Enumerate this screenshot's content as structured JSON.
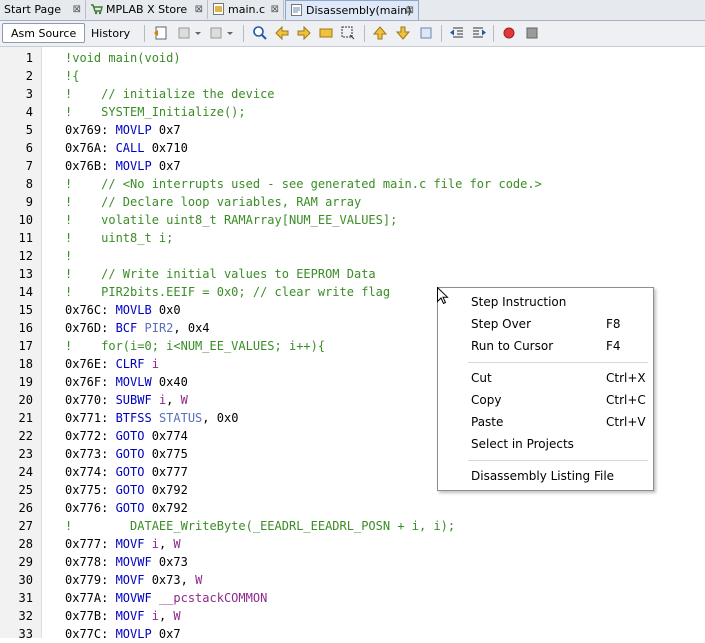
{
  "tabs": [
    {
      "label": "Start Page"
    },
    {
      "label": "MPLAB X Store"
    },
    {
      "label": "main.c"
    },
    {
      "label": "Disassembly(main)"
    }
  ],
  "toolbar": {
    "asm_source": "Asm Source",
    "history": "History"
  },
  "lines": [
    {
      "n": "1",
      "parts": [
        {
          "t": "!void main(void)",
          "c": "src"
        }
      ]
    },
    {
      "n": "2",
      "parts": [
        {
          "t": "!{",
          "c": "src"
        }
      ]
    },
    {
      "n": "3",
      "parts": [
        {
          "t": "!    // initialize the device",
          "c": "src"
        }
      ]
    },
    {
      "n": "4",
      "parts": [
        {
          "t": "!    SYSTEM_Initialize();",
          "c": "src"
        }
      ]
    },
    {
      "n": "5",
      "parts": [
        {
          "t": "0x769: ",
          "c": "addr"
        },
        {
          "t": "MOVLP",
          "c": "kw"
        },
        {
          "t": " 0x7",
          "c": "num"
        }
      ]
    },
    {
      "n": "6",
      "parts": [
        {
          "t": "0x76A: ",
          "c": "addr"
        },
        {
          "t": "CALL",
          "c": "kw"
        },
        {
          "t": " 0x710",
          "c": "num"
        }
      ]
    },
    {
      "n": "7",
      "parts": [
        {
          "t": "0x76B: ",
          "c": "addr"
        },
        {
          "t": "MOVLP",
          "c": "kw"
        },
        {
          "t": " 0x7",
          "c": "num"
        }
      ]
    },
    {
      "n": "8",
      "parts": [
        {
          "t": "!    // <No interrupts used - see generated main.c file for code.>",
          "c": "src"
        }
      ]
    },
    {
      "n": "9",
      "parts": [
        {
          "t": "!    // Declare loop variables, RAM array",
          "c": "src"
        }
      ]
    },
    {
      "n": "10",
      "parts": [
        {
          "t": "!    volatile uint8_t RAMArray[NUM_EE_VALUES];",
          "c": "src"
        }
      ]
    },
    {
      "n": "11",
      "parts": [
        {
          "t": "!    uint8_t i;",
          "c": "src"
        }
      ]
    },
    {
      "n": "12",
      "parts": [
        {
          "t": "!",
          "c": "src"
        }
      ]
    },
    {
      "n": "13",
      "parts": [
        {
          "t": "!    // Write initial values to EEPROM Data",
          "c": "src"
        }
      ]
    },
    {
      "n": "14",
      "parts": [
        {
          "t": "!    PIR2bits.EEIF = 0x0; // clear write flag",
          "c": "src"
        }
      ]
    },
    {
      "n": "15",
      "parts": [
        {
          "t": "0x76C: ",
          "c": "addr"
        },
        {
          "t": "MOVLB",
          "c": "kw"
        },
        {
          "t": " 0x0",
          "c": "num"
        }
      ]
    },
    {
      "n": "16",
      "parts": [
        {
          "t": "0x76D: ",
          "c": "addr"
        },
        {
          "t": "BCF",
          "c": "kw"
        },
        {
          "t": " ",
          "c": "num"
        },
        {
          "t": "PIR2",
          "c": "reg"
        },
        {
          "t": ", 0x4",
          "c": "num"
        }
      ]
    },
    {
      "n": "17",
      "parts": [
        {
          "t": "!    for(i=0; i<NUM_EE_VALUES; i++){",
          "c": "src"
        }
      ]
    },
    {
      "n": "18",
      "parts": [
        {
          "t": "0x76E: ",
          "c": "addr"
        },
        {
          "t": "CLRF",
          "c": "kw"
        },
        {
          "t": " ",
          "c": "num"
        },
        {
          "t": "i",
          "c": "var"
        }
      ]
    },
    {
      "n": "19",
      "parts": [
        {
          "t": "0x76F: ",
          "c": "addr"
        },
        {
          "t": "MOVLW",
          "c": "kw"
        },
        {
          "t": " 0x40",
          "c": "num"
        }
      ]
    },
    {
      "n": "20",
      "parts": [
        {
          "t": "0x770: ",
          "c": "addr"
        },
        {
          "t": "SUBWF",
          "c": "kw"
        },
        {
          "t": " ",
          "c": "num"
        },
        {
          "t": "i",
          "c": "var"
        },
        {
          "t": ", ",
          "c": "num"
        },
        {
          "t": "W",
          "c": "var"
        }
      ]
    },
    {
      "n": "21",
      "parts": [
        {
          "t": "0x771: ",
          "c": "addr"
        },
        {
          "t": "BTFSS",
          "c": "kw"
        },
        {
          "t": " ",
          "c": "num"
        },
        {
          "t": "STATUS",
          "c": "reg"
        },
        {
          "t": ", 0x0",
          "c": "num"
        }
      ]
    },
    {
      "n": "22",
      "parts": [
        {
          "t": "0x772: ",
          "c": "addr"
        },
        {
          "t": "GOTO",
          "c": "kw"
        },
        {
          "t": " 0x774",
          "c": "num"
        }
      ]
    },
    {
      "n": "23",
      "parts": [
        {
          "t": "0x773: ",
          "c": "addr"
        },
        {
          "t": "GOTO",
          "c": "kw"
        },
        {
          "t": " 0x775",
          "c": "num"
        }
      ]
    },
    {
      "n": "24",
      "parts": [
        {
          "t": "0x774: ",
          "c": "addr"
        },
        {
          "t": "GOTO",
          "c": "kw"
        },
        {
          "t": " 0x777",
          "c": "num"
        }
      ]
    },
    {
      "n": "25",
      "parts": [
        {
          "t": "0x775: ",
          "c": "addr"
        },
        {
          "t": "GOTO",
          "c": "kw"
        },
        {
          "t": " 0x792",
          "c": "num"
        }
      ]
    },
    {
      "n": "26",
      "parts": [
        {
          "t": "0x776: ",
          "c": "addr"
        },
        {
          "t": "GOTO",
          "c": "kw"
        },
        {
          "t": " 0x792",
          "c": "num"
        }
      ]
    },
    {
      "n": "27",
      "parts": [
        {
          "t": "!        DATAEE_WriteByte(_EEADRL_EEADRL_POSN + i, i);",
          "c": "src"
        }
      ]
    },
    {
      "n": "28",
      "parts": [
        {
          "t": "0x777: ",
          "c": "addr"
        },
        {
          "t": "MOVF",
          "c": "kw"
        },
        {
          "t": " ",
          "c": "num"
        },
        {
          "t": "i",
          "c": "var"
        },
        {
          "t": ", ",
          "c": "num"
        },
        {
          "t": "W",
          "c": "var"
        }
      ]
    },
    {
      "n": "29",
      "parts": [
        {
          "t": "0x778: ",
          "c": "addr"
        },
        {
          "t": "MOVWF",
          "c": "kw"
        },
        {
          "t": " 0x73",
          "c": "num"
        }
      ]
    },
    {
      "n": "30",
      "parts": [
        {
          "t": "0x779: ",
          "c": "addr"
        },
        {
          "t": "MOVF",
          "c": "kw"
        },
        {
          "t": " 0x73, ",
          "c": "num"
        },
        {
          "t": "W",
          "c": "var"
        }
      ]
    },
    {
      "n": "31",
      "parts": [
        {
          "t": "0x77A: ",
          "c": "addr"
        },
        {
          "t": "MOVWF",
          "c": "kw"
        },
        {
          "t": " ",
          "c": "num"
        },
        {
          "t": "__pcstackCOMMON",
          "c": "var"
        }
      ]
    },
    {
      "n": "32",
      "parts": [
        {
          "t": "0x77B: ",
          "c": "addr"
        },
        {
          "t": "MOVF",
          "c": "kw"
        },
        {
          "t": " ",
          "c": "num"
        },
        {
          "t": "i",
          "c": "var"
        },
        {
          "t": ", ",
          "c": "num"
        },
        {
          "t": "W",
          "c": "var"
        }
      ]
    },
    {
      "n": "33",
      "parts": [
        {
          "t": "0x77C: ",
          "c": "addr"
        },
        {
          "t": "MOVLP",
          "c": "kw"
        },
        {
          "t": " 0x7",
          "c": "num"
        }
      ]
    }
  ],
  "context_menu": {
    "items": [
      {
        "label": "Step Instruction",
        "shortcut": ""
      },
      {
        "label": "Step Over",
        "shortcut": "F8"
      },
      {
        "label": "Run to Cursor",
        "shortcut": "F4"
      },
      {
        "sep": true
      },
      {
        "label": "Cut",
        "shortcut": "Ctrl+X"
      },
      {
        "label": "Copy",
        "shortcut": "Ctrl+C"
      },
      {
        "label": "Paste",
        "shortcut": "Ctrl+V"
      },
      {
        "label": "Select in Projects",
        "shortcut": ""
      },
      {
        "sep": true
      },
      {
        "label": "Disassembly Listing File",
        "shortcut": ""
      }
    ]
  },
  "colors": {
    "source_line": "#3a8d26",
    "mnemonic": "#0000c0",
    "register": "#5a6fbd",
    "variable": "#8d2a8d"
  }
}
